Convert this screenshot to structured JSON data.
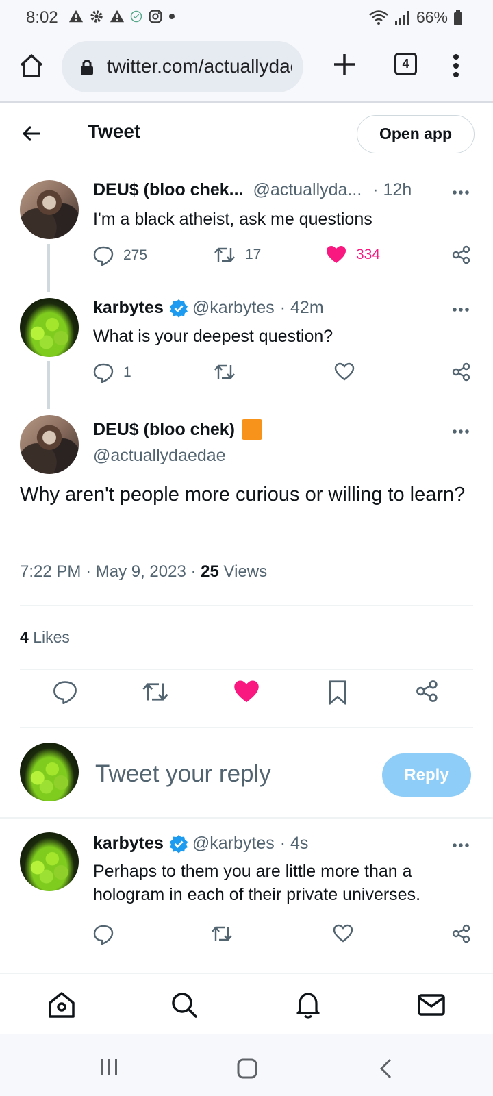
{
  "status_bar": {
    "time": "8:02",
    "battery": "66%"
  },
  "browser": {
    "url": "twitter.com/actuallydaedae",
    "tab_count": "4"
  },
  "header": {
    "title": "Tweet",
    "open_app_label": "Open app"
  },
  "tweets": [
    {
      "name": "DEU$ (bloo chek...",
      "handle": "@actuallyda...",
      "time": "· 12h",
      "text": "I'm a black atheist, ask me questions",
      "replies": "275",
      "retweets": "17",
      "likes": "334",
      "liked": true
    },
    {
      "name": "karbytes",
      "handle": "@karbytes",
      "time": "· 42m",
      "text": "What is your deepest question?",
      "replies": "1",
      "retweets": "",
      "likes": "",
      "verified": true
    }
  ],
  "main_tweet": {
    "name": "DEU$ (bloo chek)",
    "badge_color": "#f7931a",
    "handle": "@actuallydaedae",
    "text": "Why aren't people more curious or willing to learn?",
    "time": "7:22 PM",
    "date": "May 9, 2023",
    "views_count": "25",
    "views_label": "Views",
    "likes_count": "4",
    "likes_label": "Likes"
  },
  "reply_box": {
    "placeholder": "Tweet your reply",
    "button_label": "Reply"
  },
  "reply_tweet": {
    "name": "karbytes",
    "handle": "@karbytes",
    "time": "· 4s",
    "text": "Perhaps to them you are little more than a hologram in each of their private universes.",
    "verified": true
  },
  "colors": {
    "like_pink": "#f91880",
    "verified_blue": "#1d9bf0",
    "reply_button": "#8ecdf7",
    "secondary_text": "#536471"
  },
  "icons": [
    "home-icon",
    "lock-icon",
    "plus-icon",
    "tabs-icon",
    "kebab-menu-icon",
    "back-arrow-icon",
    "reply-icon",
    "retweet-icon",
    "heart-icon",
    "share-icon",
    "bookmark-icon",
    "search-icon",
    "bell-icon",
    "mail-icon"
  ]
}
